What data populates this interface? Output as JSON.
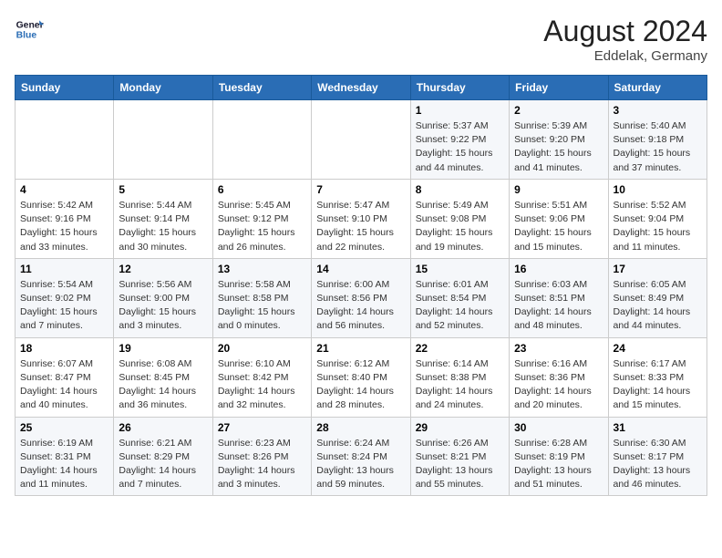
{
  "header": {
    "logo_line1": "General",
    "logo_line2": "Blue",
    "month_year": "August 2024",
    "location": "Eddelak, Germany"
  },
  "weekdays": [
    "Sunday",
    "Monday",
    "Tuesday",
    "Wednesday",
    "Thursday",
    "Friday",
    "Saturday"
  ],
  "weeks": [
    [
      {
        "day": "",
        "info": ""
      },
      {
        "day": "",
        "info": ""
      },
      {
        "day": "",
        "info": ""
      },
      {
        "day": "",
        "info": ""
      },
      {
        "day": "1",
        "info": "Sunrise: 5:37 AM\nSunset: 9:22 PM\nDaylight: 15 hours\nand 44 minutes."
      },
      {
        "day": "2",
        "info": "Sunrise: 5:39 AM\nSunset: 9:20 PM\nDaylight: 15 hours\nand 41 minutes."
      },
      {
        "day": "3",
        "info": "Sunrise: 5:40 AM\nSunset: 9:18 PM\nDaylight: 15 hours\nand 37 minutes."
      }
    ],
    [
      {
        "day": "4",
        "info": "Sunrise: 5:42 AM\nSunset: 9:16 PM\nDaylight: 15 hours\nand 33 minutes."
      },
      {
        "day": "5",
        "info": "Sunrise: 5:44 AM\nSunset: 9:14 PM\nDaylight: 15 hours\nand 30 minutes."
      },
      {
        "day": "6",
        "info": "Sunrise: 5:45 AM\nSunset: 9:12 PM\nDaylight: 15 hours\nand 26 minutes."
      },
      {
        "day": "7",
        "info": "Sunrise: 5:47 AM\nSunset: 9:10 PM\nDaylight: 15 hours\nand 22 minutes."
      },
      {
        "day": "8",
        "info": "Sunrise: 5:49 AM\nSunset: 9:08 PM\nDaylight: 15 hours\nand 19 minutes."
      },
      {
        "day": "9",
        "info": "Sunrise: 5:51 AM\nSunset: 9:06 PM\nDaylight: 15 hours\nand 15 minutes."
      },
      {
        "day": "10",
        "info": "Sunrise: 5:52 AM\nSunset: 9:04 PM\nDaylight: 15 hours\nand 11 minutes."
      }
    ],
    [
      {
        "day": "11",
        "info": "Sunrise: 5:54 AM\nSunset: 9:02 PM\nDaylight: 15 hours\nand 7 minutes."
      },
      {
        "day": "12",
        "info": "Sunrise: 5:56 AM\nSunset: 9:00 PM\nDaylight: 15 hours\nand 3 minutes."
      },
      {
        "day": "13",
        "info": "Sunrise: 5:58 AM\nSunset: 8:58 PM\nDaylight: 15 hours\nand 0 minutes."
      },
      {
        "day": "14",
        "info": "Sunrise: 6:00 AM\nSunset: 8:56 PM\nDaylight: 14 hours\nand 56 minutes."
      },
      {
        "day": "15",
        "info": "Sunrise: 6:01 AM\nSunset: 8:54 PM\nDaylight: 14 hours\nand 52 minutes."
      },
      {
        "day": "16",
        "info": "Sunrise: 6:03 AM\nSunset: 8:51 PM\nDaylight: 14 hours\nand 48 minutes."
      },
      {
        "day": "17",
        "info": "Sunrise: 6:05 AM\nSunset: 8:49 PM\nDaylight: 14 hours\nand 44 minutes."
      }
    ],
    [
      {
        "day": "18",
        "info": "Sunrise: 6:07 AM\nSunset: 8:47 PM\nDaylight: 14 hours\nand 40 minutes."
      },
      {
        "day": "19",
        "info": "Sunrise: 6:08 AM\nSunset: 8:45 PM\nDaylight: 14 hours\nand 36 minutes."
      },
      {
        "day": "20",
        "info": "Sunrise: 6:10 AM\nSunset: 8:42 PM\nDaylight: 14 hours\nand 32 minutes."
      },
      {
        "day": "21",
        "info": "Sunrise: 6:12 AM\nSunset: 8:40 PM\nDaylight: 14 hours\nand 28 minutes."
      },
      {
        "day": "22",
        "info": "Sunrise: 6:14 AM\nSunset: 8:38 PM\nDaylight: 14 hours\nand 24 minutes."
      },
      {
        "day": "23",
        "info": "Sunrise: 6:16 AM\nSunset: 8:36 PM\nDaylight: 14 hours\nand 20 minutes."
      },
      {
        "day": "24",
        "info": "Sunrise: 6:17 AM\nSunset: 8:33 PM\nDaylight: 14 hours\nand 15 minutes."
      }
    ],
    [
      {
        "day": "25",
        "info": "Sunrise: 6:19 AM\nSunset: 8:31 PM\nDaylight: 14 hours\nand 11 minutes."
      },
      {
        "day": "26",
        "info": "Sunrise: 6:21 AM\nSunset: 8:29 PM\nDaylight: 14 hours\nand 7 minutes."
      },
      {
        "day": "27",
        "info": "Sunrise: 6:23 AM\nSunset: 8:26 PM\nDaylight: 14 hours\nand 3 minutes."
      },
      {
        "day": "28",
        "info": "Sunrise: 6:24 AM\nSunset: 8:24 PM\nDaylight: 13 hours\nand 59 minutes."
      },
      {
        "day": "29",
        "info": "Sunrise: 6:26 AM\nSunset: 8:21 PM\nDaylight: 13 hours\nand 55 minutes."
      },
      {
        "day": "30",
        "info": "Sunrise: 6:28 AM\nSunset: 8:19 PM\nDaylight: 13 hours\nand 51 minutes."
      },
      {
        "day": "31",
        "info": "Sunrise: 6:30 AM\nSunset: 8:17 PM\nDaylight: 13 hours\nand 46 minutes."
      }
    ]
  ]
}
